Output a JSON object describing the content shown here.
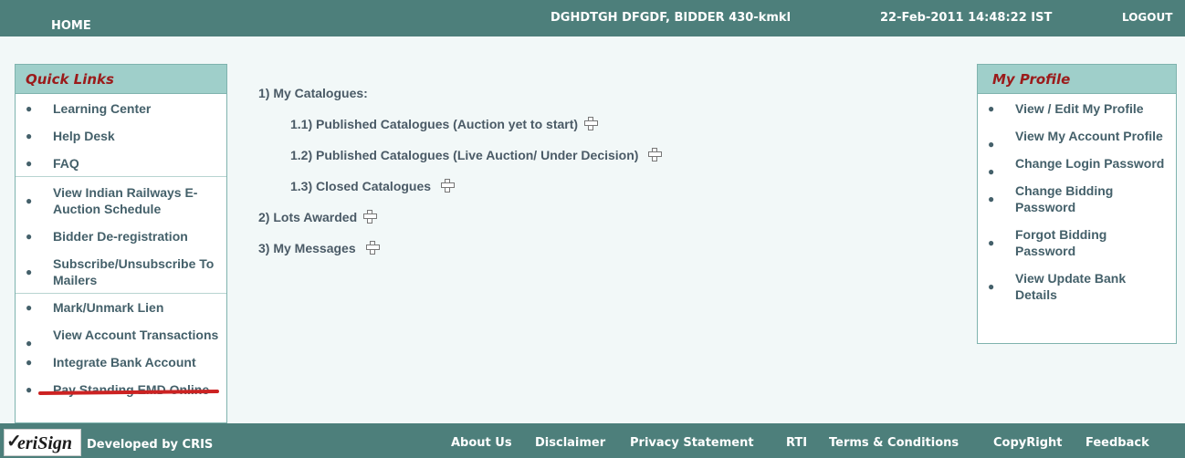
{
  "header": {
    "home": "HOME",
    "user": "DGHDTGH DFGDF, BIDDER 430-kmkl",
    "datetime": "22-Feb-2011 14:48:22 IST",
    "logout": "LOGOUT"
  },
  "quick_links": {
    "title": "Quick Links",
    "groups": [
      [
        "Learning Center",
        "Help Desk",
        "FAQ"
      ],
      [
        "View Indian Railways E-Auction Schedule",
        "Bidder De-registration",
        "Subscribe/Unsubscribe To Mailers"
      ],
      [
        "Mark/Unmark Lien",
        "View Account Transactions",
        "Integrate Bank Account",
        "Pay Standing EMD Online"
      ]
    ]
  },
  "main": {
    "my_catalogues": "1)  My Catalogues:",
    "published_yet_to_start": "1.1) Published Catalogues (Auction yet to start)",
    "published_live": "1.2) Published Catalogues (Live Auction/ Under Decision)",
    "closed": "1.3) Closed Catalogues",
    "lots_awarded": "2) Lots Awarded",
    "my_messages": "3) My Messages"
  },
  "my_profile": {
    "title": "My Profile",
    "items": [
      "View / Edit My Profile",
      "View My Account Profile",
      "Change Login Password",
      "Change Bidding Password",
      "Forgot Bidding Password",
      "View Update Bank Details"
    ]
  },
  "footer": {
    "logo_text": "eriSign",
    "developed_by": "Developed by CRIS",
    "links": [
      "About Us",
      "Disclaimer",
      "Privacy Statement",
      "RTI",
      "Terms & Conditions",
      "CopyRight",
      "Feedback"
    ]
  },
  "colors": {
    "header_bg": "#4d7f7b",
    "panel_head_bg": "#9fcfca",
    "panel_title": "#9b1b1b",
    "link_text": "#44606a",
    "annotation_underline": "#cc2222"
  },
  "icons": {
    "expand": "plus-icon",
    "bullet": "bullet-icon",
    "logo": "verisign-logo"
  }
}
